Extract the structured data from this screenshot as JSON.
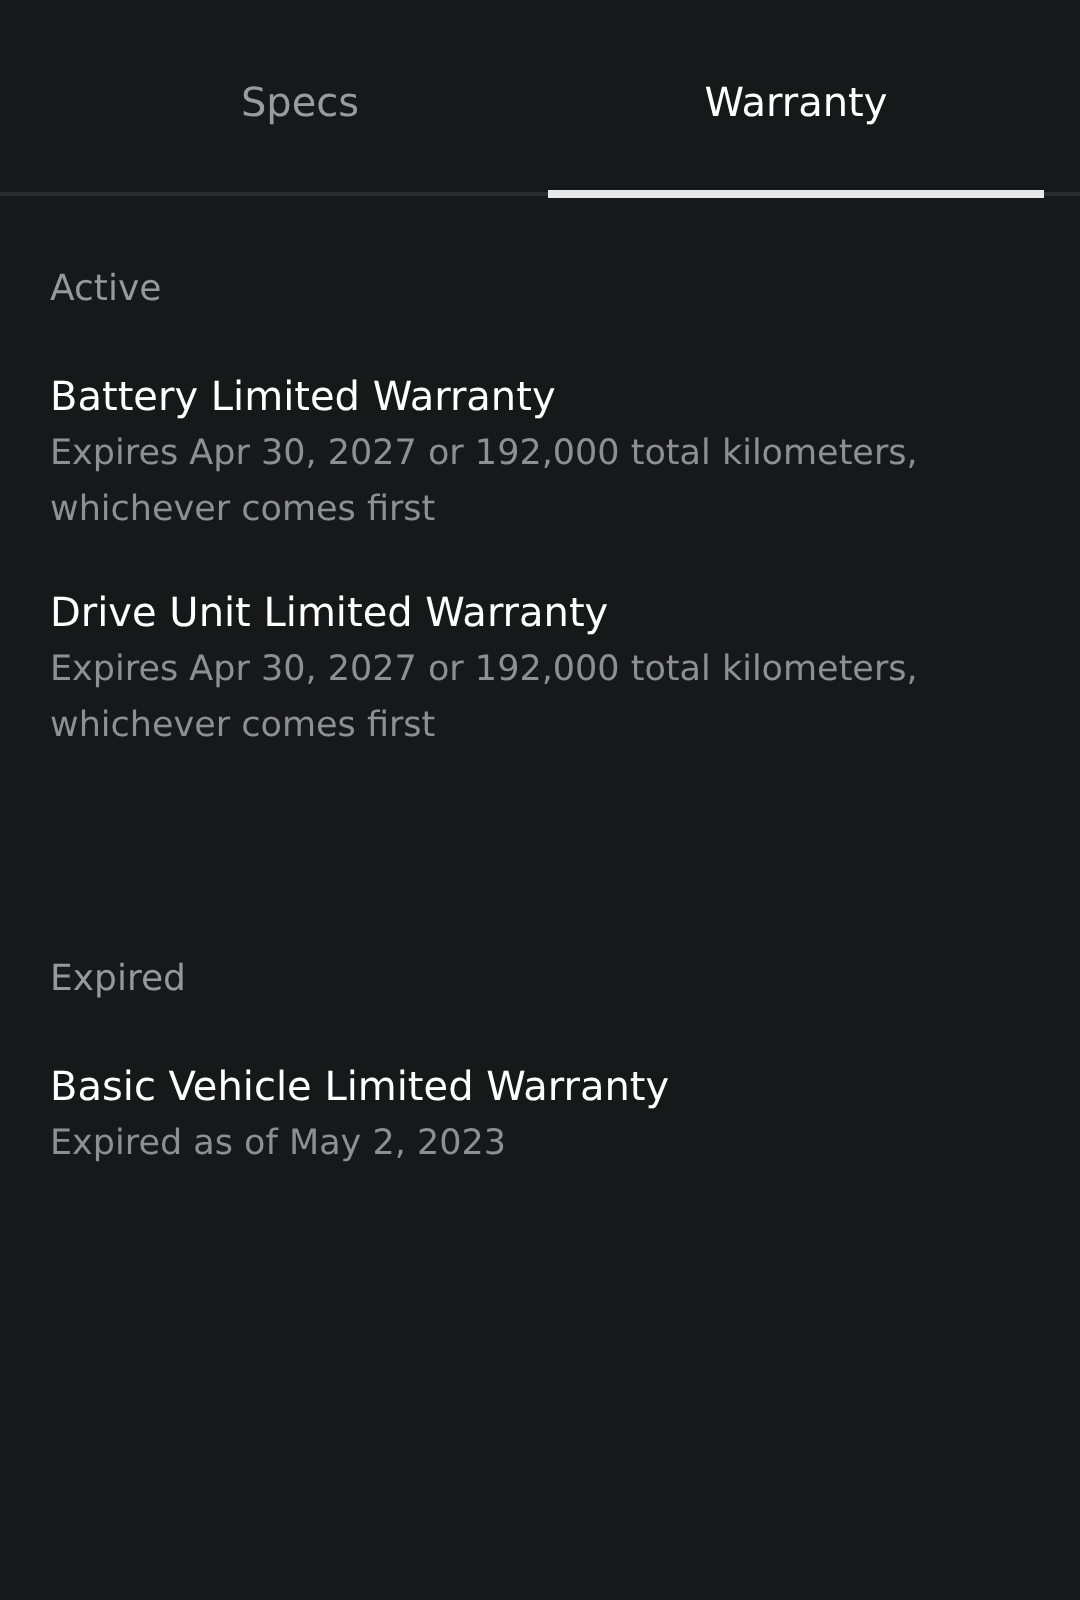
{
  "tabs": [
    {
      "label": "Specs",
      "selected": false
    },
    {
      "label": "Warranty",
      "selected": true
    }
  ],
  "sections": [
    {
      "heading": "Active",
      "items": [
        {
          "title": "Battery Limited Warranty",
          "detail": "Expires Apr 30, 2027 or 192,000 total kilometers, whichever comes first"
        },
        {
          "title": "Drive Unit Limited Warranty",
          "detail": "Expires Apr 30, 2027 or 192,000 total kilometers, whichever comes first"
        }
      ]
    },
    {
      "heading": "Expired",
      "items": [
        {
          "title": "Basic Vehicle Limited Warranty",
          "detail": "Expired as of May 2, 2023"
        }
      ]
    }
  ]
}
